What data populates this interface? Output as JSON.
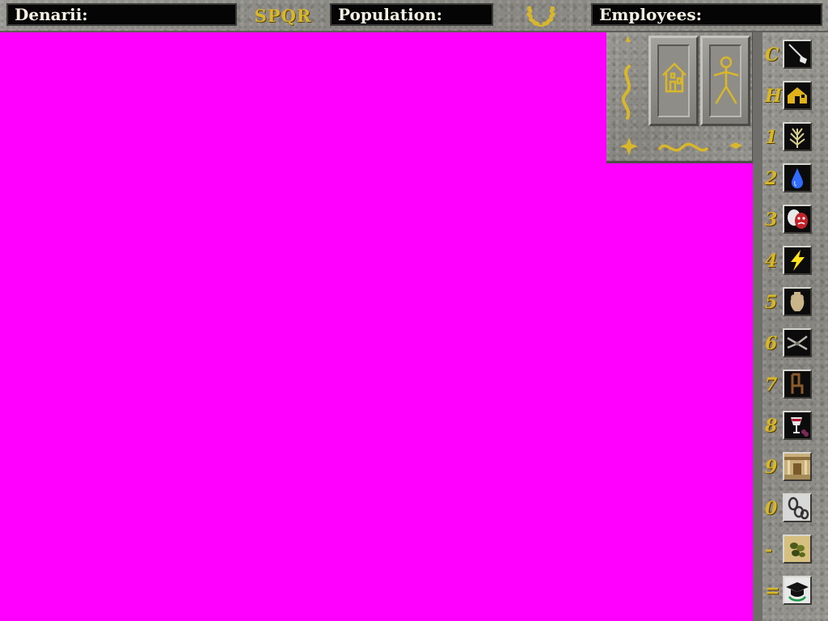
{
  "topbar": {
    "denarii_label": "Denarii:",
    "spqr_label": "SPQR",
    "population_label": "Population:",
    "employees_label": "Employees:"
  },
  "colors": {
    "map_background": "#ff00ff",
    "gold_text": "#d9b72a",
    "field_background": "#050505"
  },
  "sidebar": {
    "items": [
      {
        "key": "C",
        "icon": "shovel-icon"
      },
      {
        "key": "H",
        "icon": "house-icon"
      },
      {
        "key": "1",
        "icon": "wheat-icon"
      },
      {
        "key": "2",
        "icon": "water-drop-icon"
      },
      {
        "key": "3",
        "icon": "theater-masks-icon"
      },
      {
        "key": "4",
        "icon": "lightning-icon"
      },
      {
        "key": "5",
        "icon": "amphora-icon"
      },
      {
        "key": "6",
        "icon": "tongs-icon"
      },
      {
        "key": "7",
        "icon": "chair-icon"
      },
      {
        "key": "8",
        "icon": "wine-cup-icon"
      },
      {
        "key": "9",
        "icon": "temple-interior-icon"
      },
      {
        "key": "0",
        "icon": "chains-icon"
      },
      {
        "key": "-",
        "icon": "olives-icon"
      },
      {
        "key": "=",
        "icon": "graduation-cap-icon"
      }
    ]
  }
}
